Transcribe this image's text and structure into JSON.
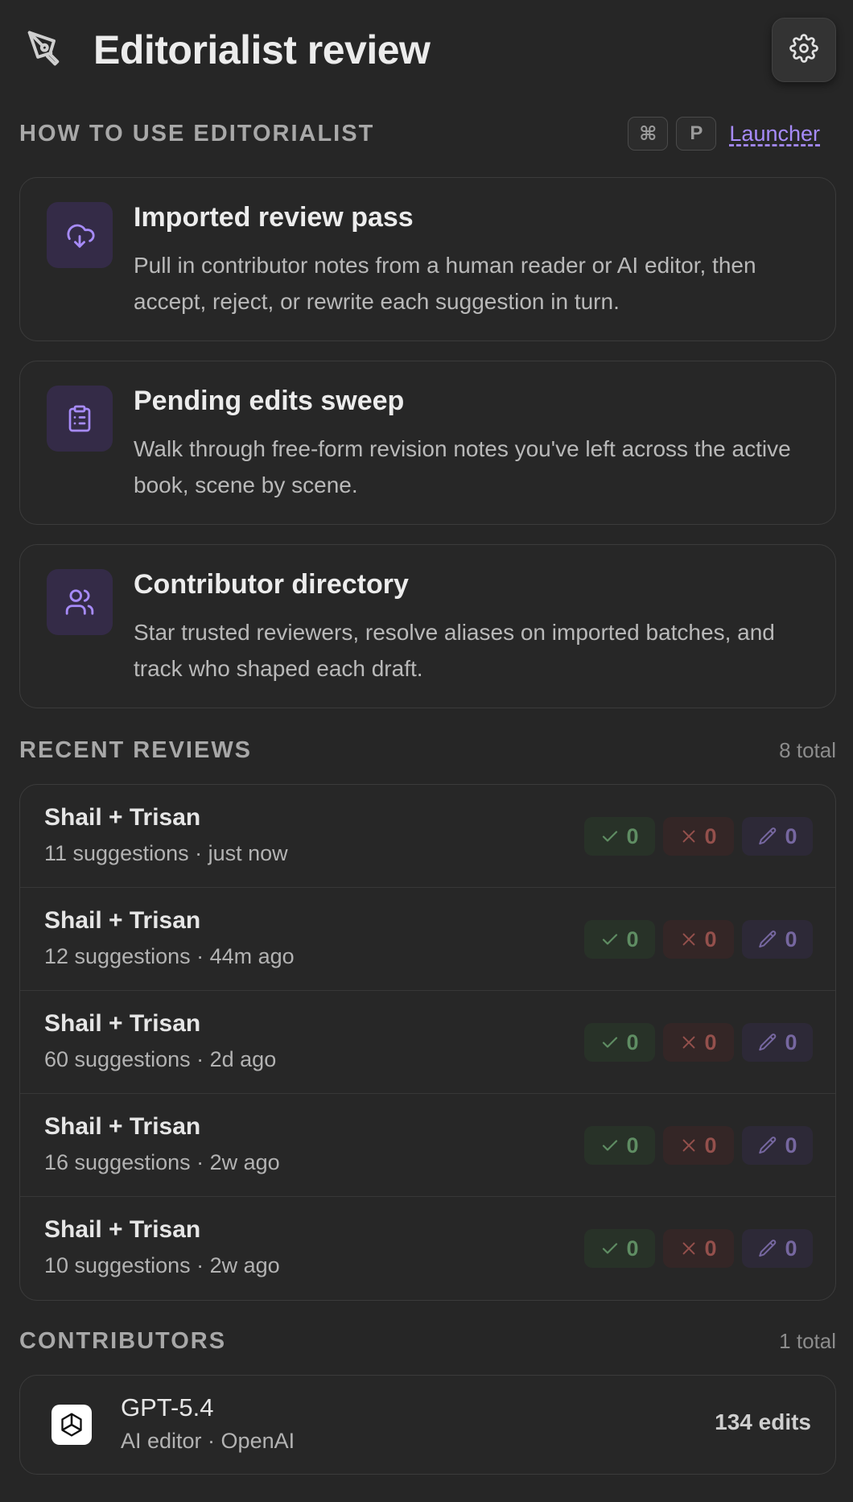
{
  "header": {
    "title": "Editorialist review",
    "logo_icon": "pen-nib-icon",
    "settings_icon": "gear-icon"
  },
  "how_to": {
    "section_title": "HOW TO USE EDITORIALIST",
    "shortcut_keys": [
      "⌘",
      "P"
    ],
    "launcher_label": "Launcher",
    "cards": [
      {
        "icon": "cloud-download-icon",
        "title": "Imported review pass",
        "description": "Pull in contributor notes from a human reader or AI editor, then accept, reject, or rewrite each suggestion in turn."
      },
      {
        "icon": "clipboard-list-icon",
        "title": "Pending edits sweep",
        "description": "Walk through free-form revision notes you've left across the active book, scene by scene."
      },
      {
        "icon": "users-icon",
        "title": "Contributor directory",
        "description": "Star trusted reviewers, resolve aliases on imported batches, and track who shaped each draft."
      }
    ]
  },
  "recent_reviews": {
    "section_title": "RECENT REVIEWS",
    "total_label": "8 total",
    "rows": [
      {
        "name": "Shail + Trisan",
        "meta": "11 suggestions · just now",
        "accepted": "0",
        "rejected": "0",
        "rewritten": "0"
      },
      {
        "name": "Shail + Trisan",
        "meta": "12 suggestions · 44m ago",
        "accepted": "0",
        "rejected": "0",
        "rewritten": "0"
      },
      {
        "name": "Shail + Trisan",
        "meta": "60 suggestions · 2d ago",
        "accepted": "0",
        "rejected": "0",
        "rewritten": "0"
      },
      {
        "name": "Shail + Trisan",
        "meta": "16 suggestions · 2w ago",
        "accepted": "0",
        "rejected": "0",
        "rewritten": "0"
      },
      {
        "name": "Shail + Trisan",
        "meta": "10 suggestions · 2w ago",
        "accepted": "0",
        "rejected": "0",
        "rewritten": "0"
      }
    ]
  },
  "contributors": {
    "section_title": "CONTRIBUTORS",
    "total_label": "1 total",
    "rows": [
      {
        "name": "GPT-5.4",
        "meta": "AI editor · OpenAI",
        "edits": "134 edits",
        "avatar_icon": "openai-logo-icon"
      }
    ]
  },
  "colors": {
    "background": "#262626",
    "accent": "#a78bfa",
    "accepted": "#5f8d63",
    "rejected": "#94504c",
    "rewritten": "#7667a0"
  }
}
